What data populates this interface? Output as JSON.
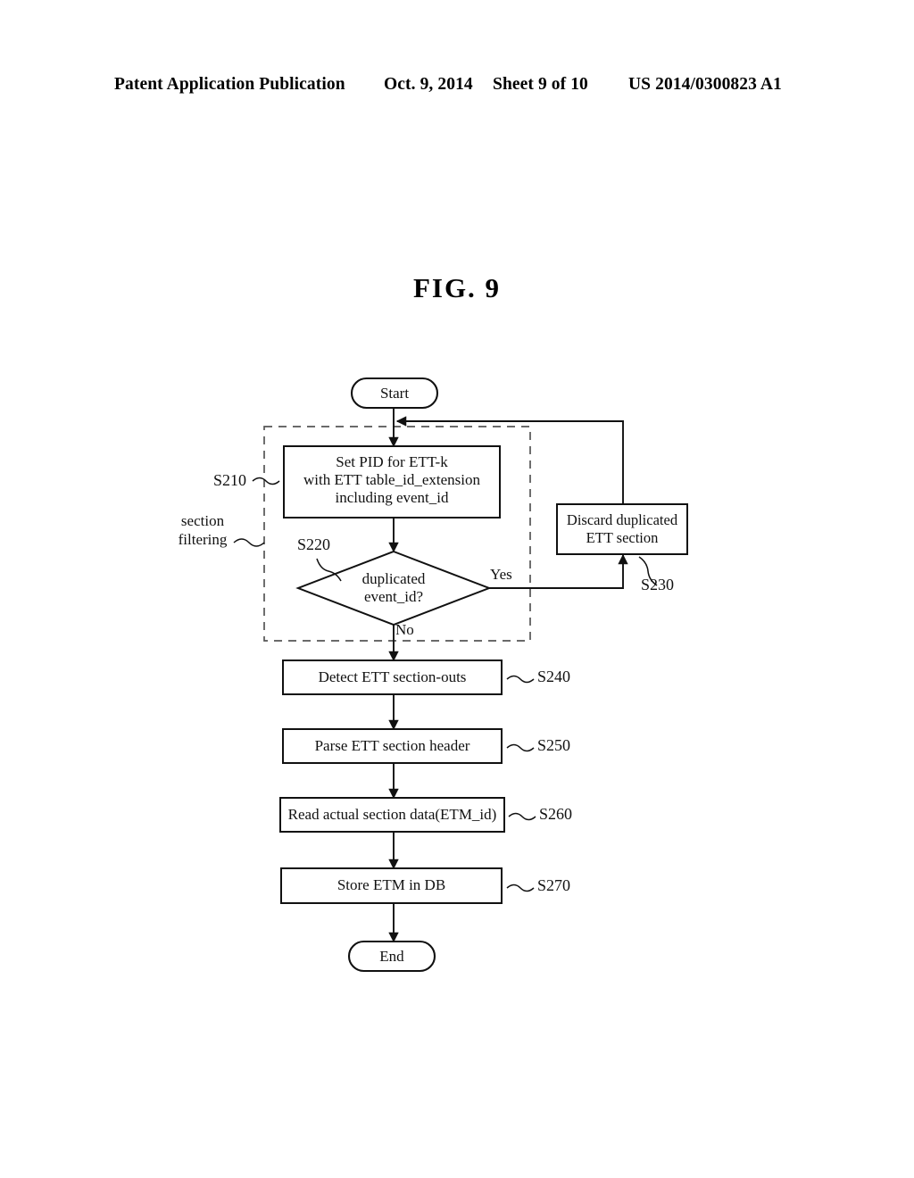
{
  "header": {
    "publication": "Patent Application Publication",
    "date": "Oct. 9, 2014",
    "sheet": "Sheet 9 of 10",
    "document_number": "US 2014/0300823 A1"
  },
  "figure": {
    "title": "FIG. 9"
  },
  "flowchart": {
    "start_label": "Start",
    "end_label": "End",
    "group_label_line1": "section",
    "group_label_line2": "filtering",
    "nodes": {
      "set_pid": {
        "line1": "Set PID for ETT-k",
        "line2": "with ETT table_id_extension",
        "line3": "including event_id",
        "ref": "S210"
      },
      "duplicated": {
        "line1": "duplicated",
        "line2": "event_id?",
        "ref": "S220",
        "yes_label": "Yes",
        "no_label": "No"
      },
      "discard": {
        "line1": "Discard duplicated",
        "line2": "ETT section",
        "ref": "S230"
      },
      "detect": {
        "line1": "Detect ETT section-outs",
        "ref": "S240"
      },
      "parse": {
        "line1": "Parse ETT section header",
        "ref": "S250"
      },
      "read": {
        "line1": "Read actual section data(ETM_id)",
        "ref": "S260"
      },
      "store": {
        "line1": "Store ETM in DB",
        "ref": "S270"
      }
    }
  },
  "colors": {
    "ink": "#111111",
    "paper": "#ffffff"
  }
}
